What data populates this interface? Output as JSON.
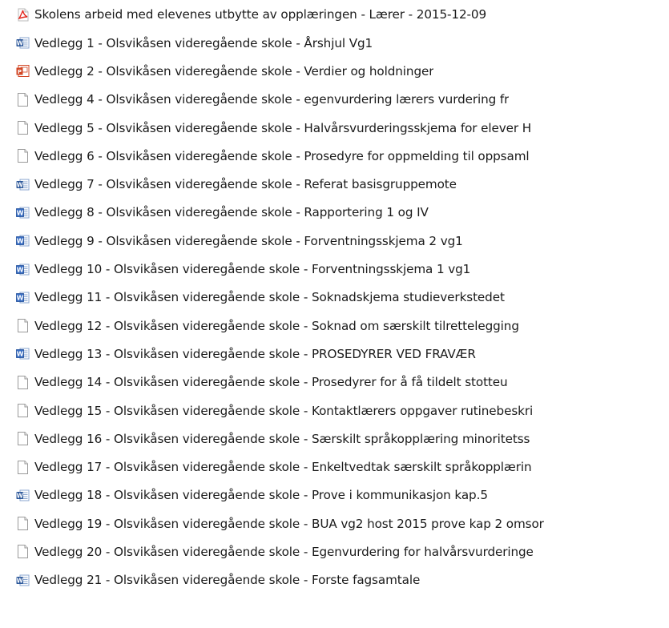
{
  "files": [
    {
      "name": "Skolens arbeid med elevenes utbytte av opplæringen  - Lærer - 2015-12-09",
      "icon": "pdf-icon"
    },
    {
      "name": "Vedlegg 1 - Olsvikåsen videregående skole - Årshjul Vg1",
      "icon": "word-doc-icon"
    },
    {
      "name": "Vedlegg 2 - Olsvikåsen videregående skole - Verdier og holdninger",
      "icon": "powerpoint-icon"
    },
    {
      "name": "Vedlegg 4 - Olsvikåsen videregående skole - egenvurdering   lærers vurdering  fr",
      "icon": "blank-file-icon"
    },
    {
      "name": "Vedlegg 5 - Olsvikåsen videregående skole - Halvårsvurderingsskjema for elever H",
      "icon": "blank-file-icon"
    },
    {
      "name": "Vedlegg 6 - Olsvikåsen videregående skole - Prosedyre for oppmelding til oppsaml",
      "icon": "blank-file-icon"
    },
    {
      "name": "Vedlegg 7 - Olsvikåsen videregående skole - Referat basisgruppemote",
      "icon": "word-doc-icon"
    },
    {
      "name": "Vedlegg 8 - Olsvikåsen videregående skole - Rapportering 1 og IV",
      "icon": "word-legacy-icon"
    },
    {
      "name": "Vedlegg 9 - Olsvikåsen videregående skole - Forventningsskjema 2 vg1",
      "icon": "word-legacy-icon"
    },
    {
      "name": "Vedlegg 10 - Olsvikåsen videregående skole - Forventningsskjema 1 vg1",
      "icon": "word-legacy-icon"
    },
    {
      "name": "Vedlegg 11 - Olsvikåsen videregående skole - Soknadskjema studieverkstedet",
      "icon": "word-legacy-icon"
    },
    {
      "name": "Vedlegg 12 - Olsvikåsen videregående skole - Soknad om særskilt tilrettelegging",
      "icon": "blank-file-icon"
    },
    {
      "name": "Vedlegg 13 - Olsvikåsen videregående skole - PROSEDYRER VED FRAVÆR",
      "icon": "word-legacy-icon"
    },
    {
      "name": "Vedlegg 14 - Olsvikåsen videregående skole - Prosedyrer for å få tildelt stotteu",
      "icon": "blank-file-icon"
    },
    {
      "name": "Vedlegg 15 - Olsvikåsen videregående skole - Kontaktlærers oppgaver rutinebeskri",
      "icon": "blank-file-icon"
    },
    {
      "name": "Vedlegg 16 - Olsvikåsen videregående skole - Særskilt språkopplæring minoritetss",
      "icon": "blank-file-icon"
    },
    {
      "name": "Vedlegg 17 - Olsvikåsen videregående skole - Enkeltvedtak særskilt språkopplærin",
      "icon": "blank-file-icon"
    },
    {
      "name": "Vedlegg 18 - Olsvikåsen videregående skole - Prove i kommunikasjon kap.5",
      "icon": "word-doc-icon"
    },
    {
      "name": "Vedlegg 19 - Olsvikåsen videregående skole - BUA vg2 host 2015 prove kap 2 omsor",
      "icon": "blank-file-icon"
    },
    {
      "name": "Vedlegg 20 - Olsvikåsen videregående skole - Egenvurdering for halvårsvurderinge",
      "icon": "blank-file-icon"
    },
    {
      "name": "Vedlegg 21 - Olsvikåsen videregående skole - Forste fagsamtale",
      "icon": "word-doc-icon"
    }
  ],
  "colors": {
    "pdf_red": "#e2261c",
    "word_blue": "#2b579a",
    "word_legacy_blue": "#3a6fc4",
    "powerpoint_red": "#d24726",
    "file_outline": "#9a9a9a",
    "text": "#1a1a1a"
  }
}
